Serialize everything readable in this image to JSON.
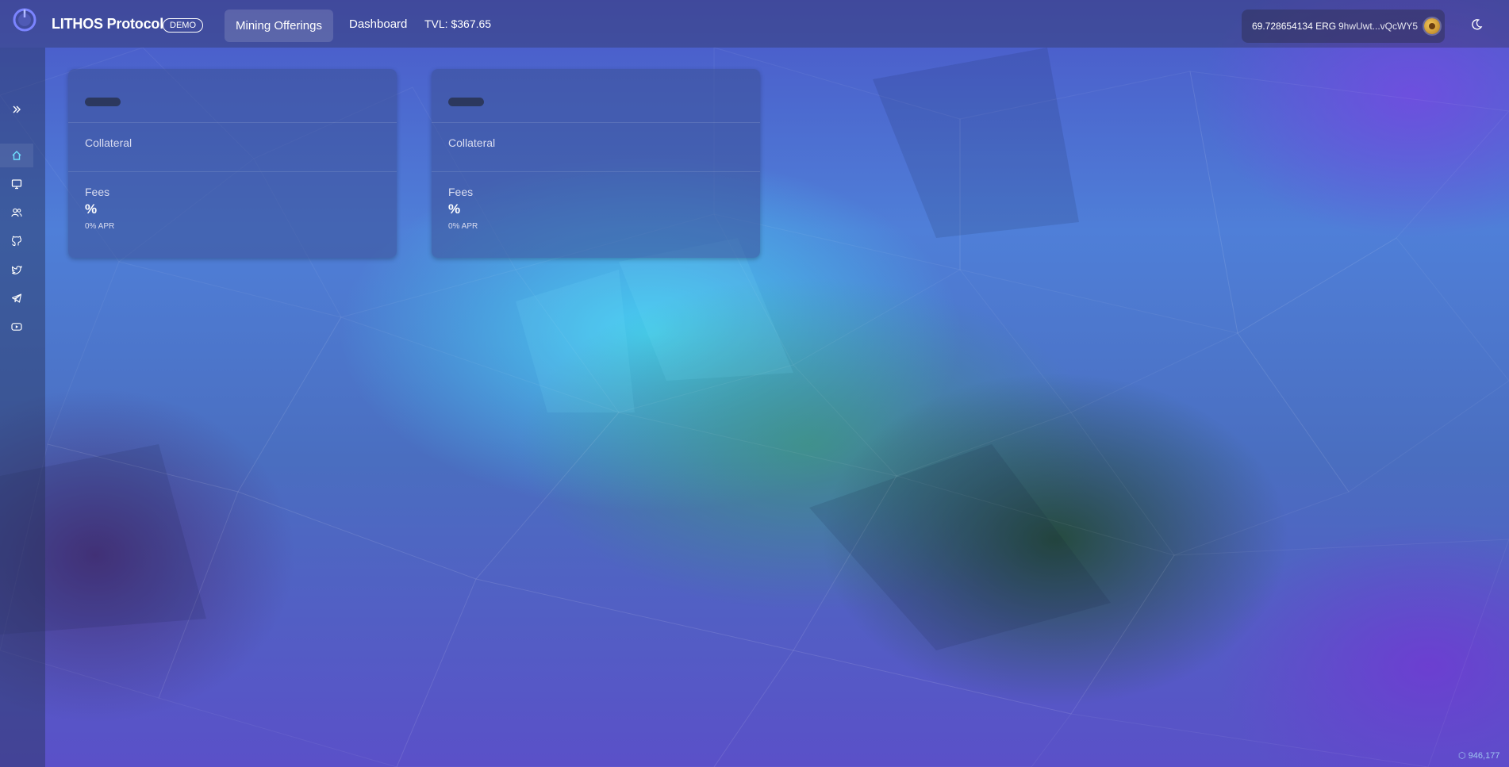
{
  "app": {
    "brand": "LITHOS Protocol",
    "badge": "DEMO"
  },
  "nav": {
    "items": [
      {
        "label": "Mining Offerings",
        "active": true
      },
      {
        "label": "Dashboard",
        "active": false
      }
    ],
    "tvl": "TVL: $367.65"
  },
  "wallet": {
    "balance": "69.728654134 ERG",
    "address": "9hwUwt...vQcWY5"
  },
  "sidebar": {
    "icons": [
      "expand-icon",
      "home-icon",
      "monitor-icon",
      "users-icon",
      "github-icon",
      "twitter-icon",
      "telegram-icon",
      "youtube-icon"
    ]
  },
  "offerings": [
    {
      "collateral_label": "Collateral",
      "fees_label": "Fees",
      "fee_value": "%",
      "apr": "0% APR"
    },
    {
      "collateral_label": "Collateral",
      "fees_label": "Fees",
      "fee_value": "%",
      "apr": "0% APR"
    }
  ],
  "footer": {
    "block_height": "946,177"
  },
  "colors": {
    "background_top": "#4a58c8",
    "background_cyan": "#46d7f5",
    "background_green": "#1e4628",
    "background_violet": "#6e3cd2"
  }
}
